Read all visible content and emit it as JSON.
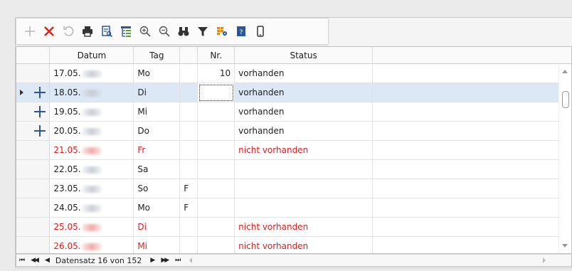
{
  "toolbar": {
    "buttons": [
      {
        "name": "add-icon",
        "color": "#b8b8b8"
      },
      {
        "name": "delete-icon",
        "color": "#e0251a"
      },
      {
        "name": "undo-icon",
        "color": "#b8b8b8"
      },
      {
        "name": "print-icon",
        "color": "#333333"
      },
      {
        "name": "print-preview-icon",
        "color": "#2b5797"
      },
      {
        "name": "tree-view-icon",
        "color": "#2b5797"
      },
      {
        "name": "zoom-in-icon",
        "color": "#555555"
      },
      {
        "name": "zoom-out-icon",
        "color": "#555555"
      },
      {
        "name": "find-icon",
        "color": "#333333"
      },
      {
        "name": "filter-icon",
        "color": "#333333"
      },
      {
        "name": "grid-settings-icon",
        "color": "#e08a1e"
      },
      {
        "name": "help-icon",
        "color": "#2b5797"
      },
      {
        "name": "mobile-icon",
        "color": "#333333"
      }
    ]
  },
  "grid": {
    "columns": [
      "Datum",
      "Tag",
      "",
      "Nr.",
      "Status"
    ],
    "rows": [
      {
        "datum": "17.05.",
        "tag": "Mo",
        "flag": "",
        "nr": "10",
        "status": "vorhanden",
        "red": false,
        "plus": false,
        "current": false
      },
      {
        "datum": "18.05.",
        "tag": "Di",
        "flag": "",
        "nr": "",
        "status": "vorhanden",
        "red": false,
        "plus": true,
        "current": true
      },
      {
        "datum": "19.05.",
        "tag": "Mi",
        "flag": "",
        "nr": "",
        "status": "vorhanden",
        "red": false,
        "plus": true,
        "current": false
      },
      {
        "datum": "20.05.",
        "tag": "Do",
        "flag": "",
        "nr": "",
        "status": "vorhanden",
        "red": false,
        "plus": true,
        "current": false
      },
      {
        "datum": "21.05.",
        "tag": "Fr",
        "flag": "",
        "nr": "",
        "status": "nicht vorhanden",
        "red": true,
        "plus": false,
        "current": false
      },
      {
        "datum": "22.05.",
        "tag": "Sa",
        "flag": "",
        "nr": "",
        "status": "",
        "red": false,
        "plus": false,
        "current": false
      },
      {
        "datum": "23.05.",
        "tag": "So",
        "flag": "F",
        "nr": "",
        "status": "",
        "red": false,
        "plus": false,
        "current": false
      },
      {
        "datum": "24.05.",
        "tag": "Mo",
        "flag": "F",
        "nr": "",
        "status": "",
        "red": false,
        "plus": false,
        "current": false
      },
      {
        "datum": "25.05.",
        "tag": "Di",
        "flag": "",
        "nr": "",
        "status": "nicht vorhanden",
        "red": true,
        "plus": false,
        "current": false
      },
      {
        "datum": "26.05.",
        "tag": "Mi",
        "flag": "",
        "nr": "",
        "status": "nicht vorhanden",
        "red": true,
        "plus": false,
        "current": false
      }
    ]
  },
  "navigator": {
    "first": "⏮",
    "prev_page": "◀◀",
    "prev": "◀",
    "record_text": "Datensatz 16 von 152",
    "next": "▶",
    "next_page": "▶▶",
    "last": "⏭"
  },
  "colors": {
    "accent": "#2b5797",
    "error_red": "#e41b1b",
    "selected_row": "#dde8f6"
  }
}
